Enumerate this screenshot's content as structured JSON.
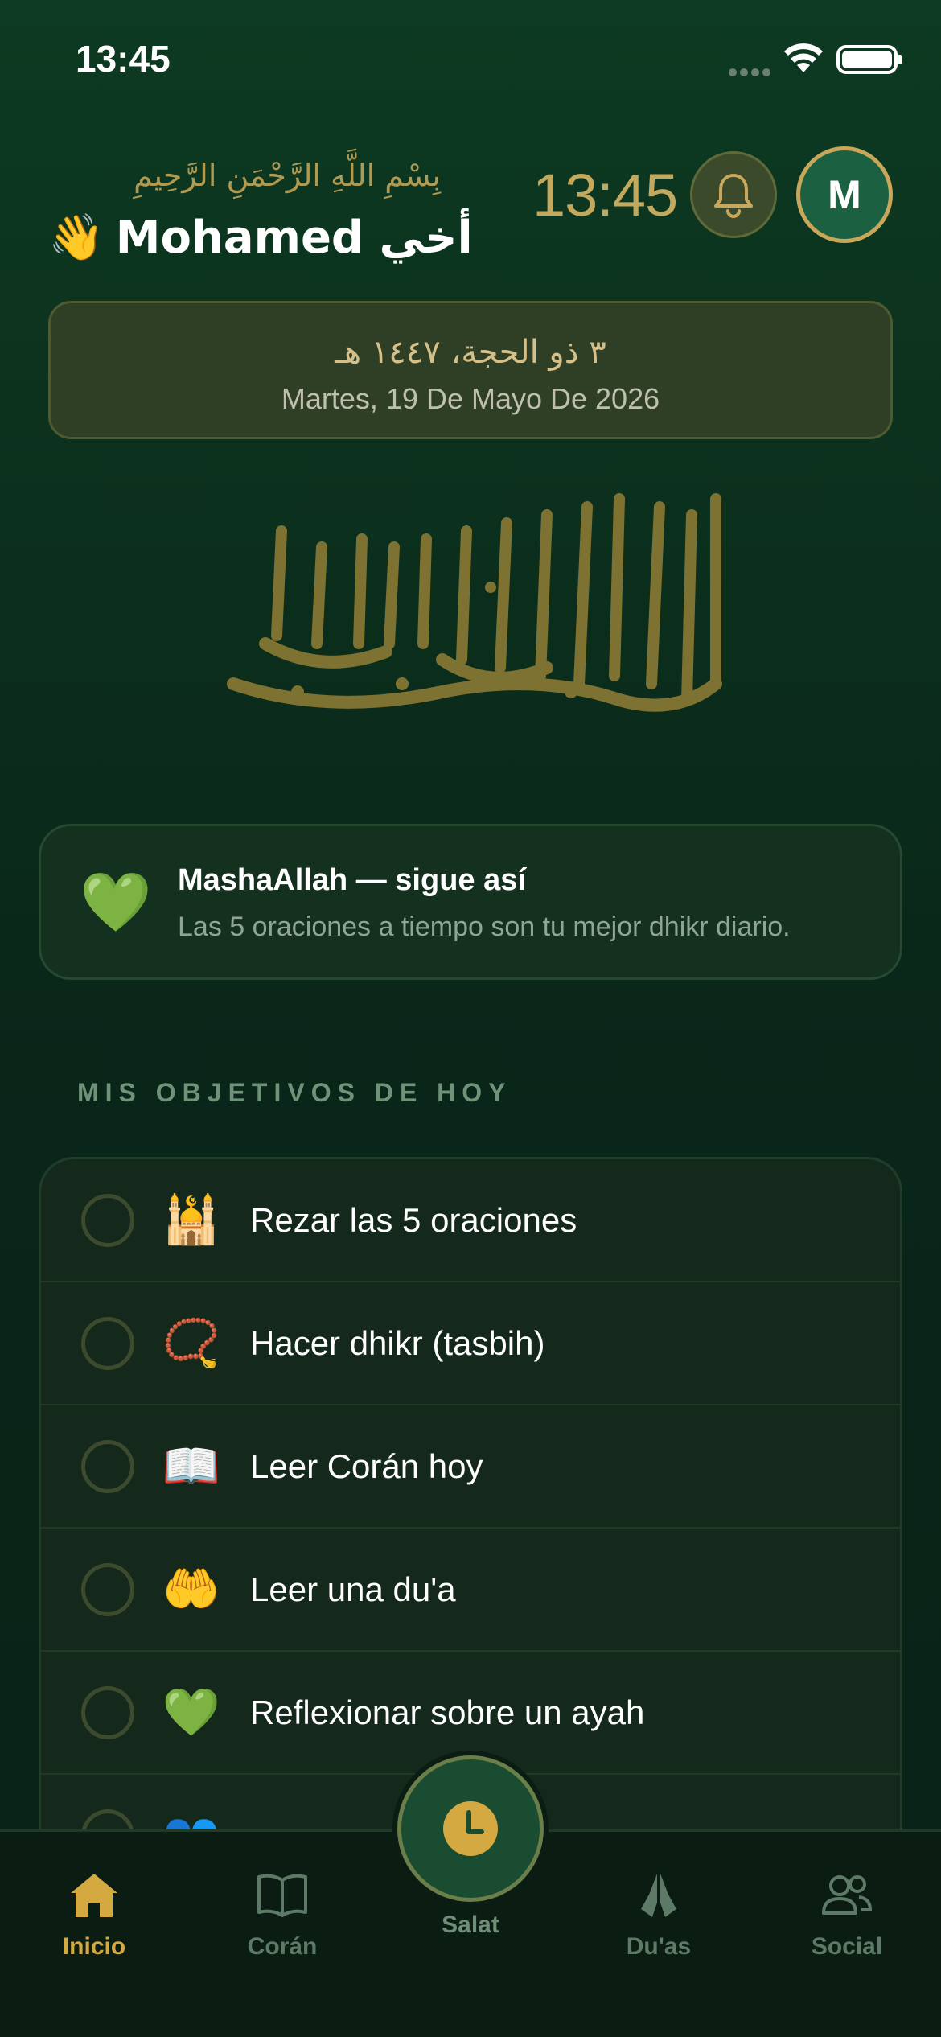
{
  "status_bar": {
    "time": "13:45"
  },
  "header": {
    "bismillah": "بِسْمِ اللَّهِ الرَّحْمَنِ الرَّحِيمِ",
    "greeting_emoji": "👋",
    "greeting": "Mohamed أخي",
    "clock": "13:45",
    "avatar_initial": "M"
  },
  "date_card": {
    "hijri": "٣ ذو الحجة، ١٤٤٧ هـ",
    "gregorian": "Martes, 19 De Mayo De 2026"
  },
  "motivation": {
    "emoji": "💚",
    "title": "MashaAllah — sigue así",
    "subtitle": "Las 5 oraciones a tiempo son tu mejor dhikr diario."
  },
  "goals": {
    "section_title": "MIS OBJETIVOS DE HOY",
    "items": [
      {
        "emoji": "🕌",
        "label": "Rezar las 5 oraciones",
        "done": false
      },
      {
        "emoji": "📿",
        "label": "Hacer dhikr (tasbih)",
        "done": false
      },
      {
        "emoji": "📖",
        "label": "Leer Corán hoy",
        "done": false
      },
      {
        "emoji": "🤲",
        "label": "Leer una du'a",
        "done": false
      },
      {
        "emoji": "💚",
        "label": "Reflexionar sobre un ayah",
        "done": false
      },
      {
        "emoji": "👥",
        "label": "",
        "done": false
      }
    ]
  },
  "tab_bar": {
    "tabs": [
      {
        "label": "Inicio",
        "icon": "home-icon",
        "active": true
      },
      {
        "label": "Corán",
        "icon": "book-icon",
        "active": false
      },
      {
        "label": "Salat",
        "icon": "clock-icon",
        "active": false
      },
      {
        "label": "Du'as",
        "icon": "praying-hands-icon",
        "active": false
      },
      {
        "label": "Social",
        "icon": "people-icon",
        "active": false
      }
    ]
  },
  "colors": {
    "accent_gold": "#d4a942",
    "background": "#0b2e1c",
    "muted_green": "#5c7a66"
  }
}
